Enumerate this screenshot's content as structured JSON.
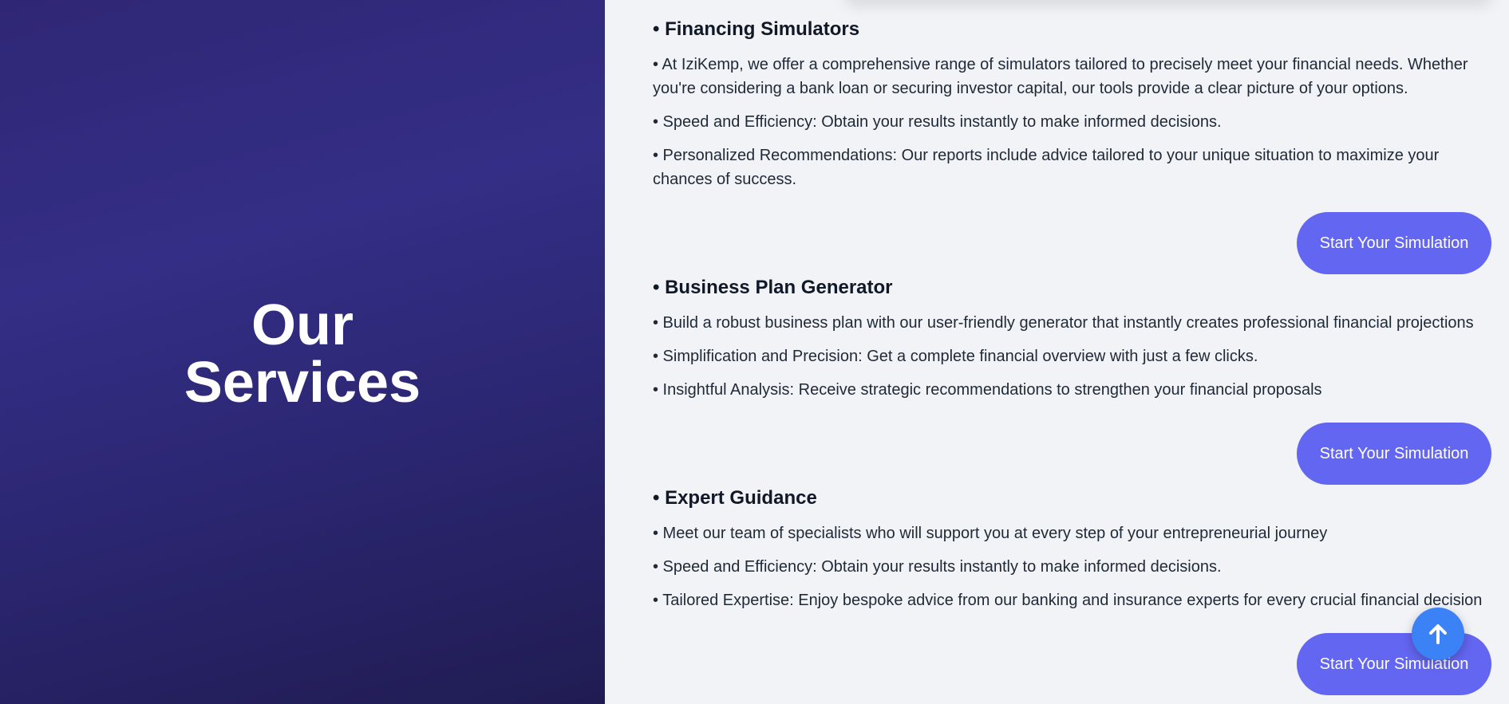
{
  "hero": {
    "title_line1": "Our",
    "title_line2": "Services"
  },
  "services": [
    {
      "title": "• Financing Simulators",
      "paragraphs": [
        "• At IziKemp, we offer a comprehensive range of simulators tailored to precisely meet your financial needs. Whether you're considering a bank loan or securing investor capital, our tools provide a clear picture of your options.",
        "• Speed and Efficiency: Obtain your results instantly to make informed decisions.",
        "• Personalized Recommendations: Our reports include advice tailored to your unique situation to maximize your chances of success."
      ],
      "button_label": "Start Your Simulation"
    },
    {
      "title": "• Business Plan Generator",
      "paragraphs": [
        "• Build a robust business plan with our user-friendly generator that instantly creates professional financial projections",
        "• Simplification and Precision: Get a complete financial overview with just a few clicks.",
        "• Insightful Analysis: Receive strategic recommendations to strengthen your financial proposals"
      ],
      "button_label": "Start Your Simulation"
    },
    {
      "title": "• Expert Guidance",
      "paragraphs": [
        "• Meet our team of specialists who will support you at every step of your entrepreneurial journey",
        "• Speed and Efficiency: Obtain your results instantly to make informed decisions.",
        "• Tailored Expertise: Enjoy bespoke advice from our banking and insurance experts for every crucial financial decision"
      ],
      "button_label": "Start Your Simulation"
    }
  ],
  "scroll_top": {
    "icon": "arrow-up-icon"
  },
  "colors": {
    "hero_background": "#2f2775",
    "content_background": "#f1f3f6",
    "button": "#6366f1",
    "scroll_top_button": "#3b82f6"
  }
}
